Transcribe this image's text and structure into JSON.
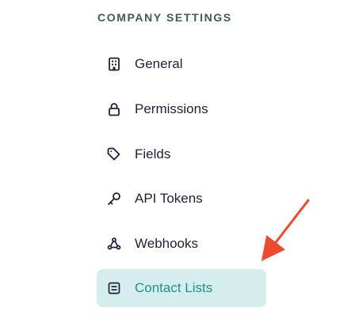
{
  "sidebar": {
    "section_title": "COMPANY SETTINGS",
    "items": [
      {
        "label": "General",
        "icon": "building-icon",
        "active": false
      },
      {
        "label": "Permissions",
        "icon": "lock-icon",
        "active": false
      },
      {
        "label": "Fields",
        "icon": "tag-icon",
        "active": false
      },
      {
        "label": "API Tokens",
        "icon": "key-icon",
        "active": false
      },
      {
        "label": "Webhooks",
        "icon": "webhook-icon",
        "active": false
      },
      {
        "label": "Contact Lists",
        "icon": "list-icon",
        "active": true
      }
    ]
  },
  "colors": {
    "heading": "#3f5a5a",
    "text": "#1f1f38",
    "active_background": "#d6eded",
    "active_text": "#1f8f8c",
    "annotation_arrow": "#f04a2e"
  }
}
